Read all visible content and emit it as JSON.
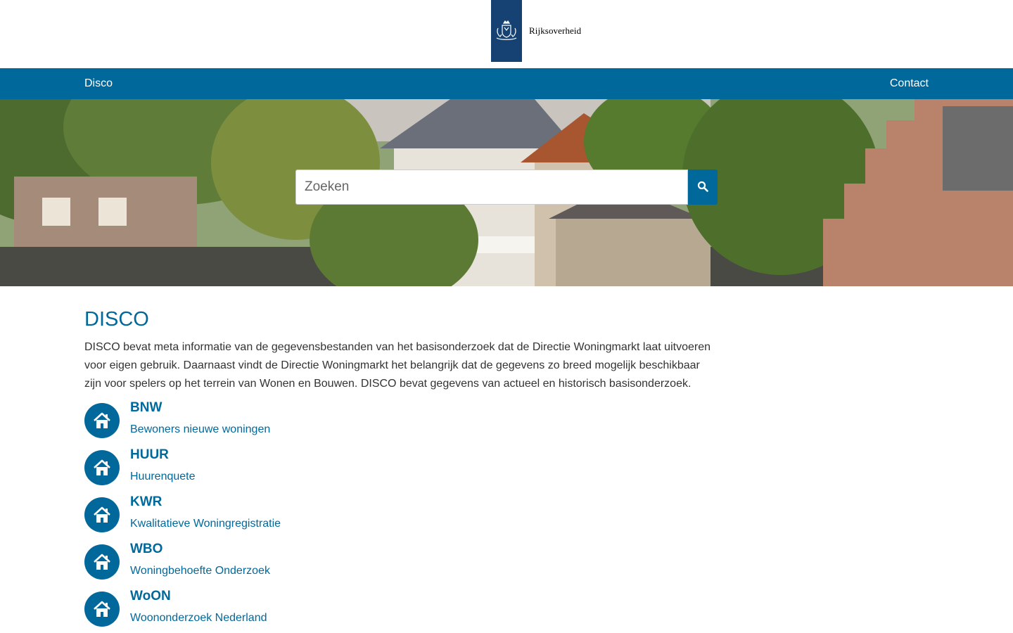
{
  "header": {
    "logo_text": "Rijksoverheid",
    "logo_icon": "crown-coat-of-arms-icon"
  },
  "nav": {
    "home_label": "Disco",
    "contact_label": "Contact",
    "background": "#01689b"
  },
  "hero": {
    "search_placeholder": "Zoeken",
    "search_icon": "search-icon"
  },
  "main": {
    "title": "DISCO",
    "intro": "DISCO bevat meta informatie van de gegevensbestanden van het basisonderzoek dat de Directie Woningmarkt laat uitvoeren voor eigen gebruik. Daarnaast vindt de Directie Woningmarkt het belangrijk dat de gegevens zo breed mogelijk beschikbaar zijn voor spelers op het terrein van Wonen en Bouwen. DISCO bevat gegevens van actueel en historisch basisonderzoek.",
    "datasets": [
      {
        "code": "BNW",
        "description": "Bewoners nieuwe woningen",
        "icon": "house-icon"
      },
      {
        "code": "HUUR",
        "description": "Huurenquete",
        "icon": "house-icon"
      },
      {
        "code": "KWR",
        "description": "Kwalitatieve Woningregistratie",
        "icon": "house-icon"
      },
      {
        "code": "WBO",
        "description": "Woningbehoefte Onderzoek",
        "icon": "house-icon"
      },
      {
        "code": "WoON",
        "description": "Woononderzoek Nederland",
        "icon": "house-icon"
      }
    ]
  },
  "colors": {
    "brand": "#01689b",
    "logo_blue": "#154273"
  }
}
